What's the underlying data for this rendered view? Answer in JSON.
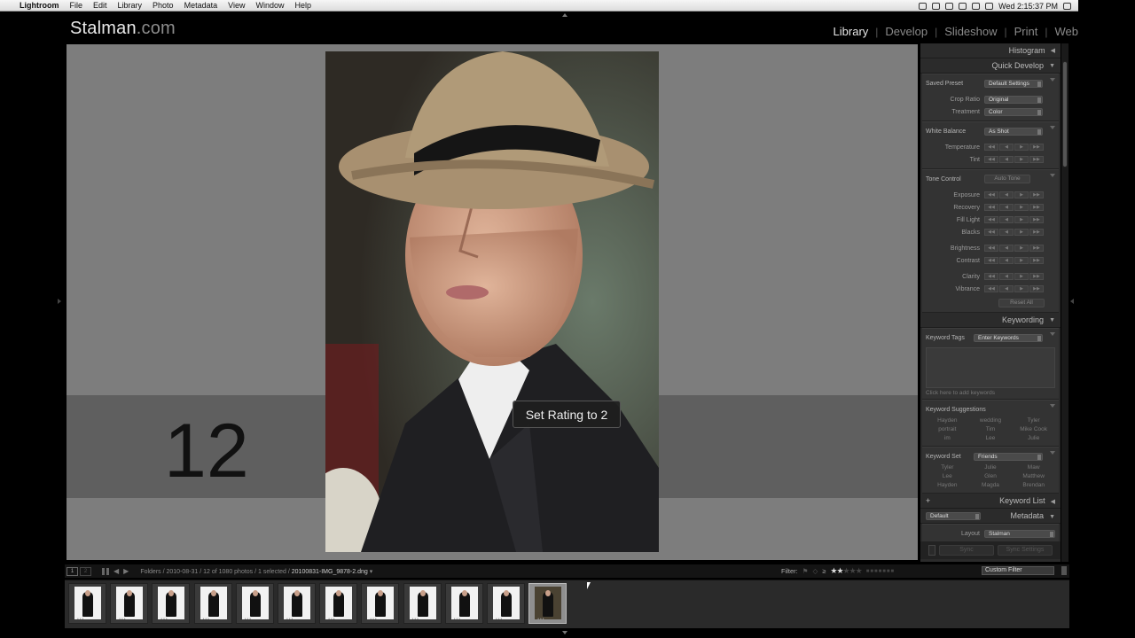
{
  "menubar": {
    "apple": "",
    "app": "Lightroom",
    "items": [
      "File",
      "Edit",
      "Library",
      "Photo",
      "Metadata",
      "View",
      "Window",
      "Help"
    ],
    "clock": "Wed 2:15:37 PM"
  },
  "identity": {
    "name": "Stalman",
    "suffix": ".com"
  },
  "modules": [
    "Library",
    "Develop",
    "Slideshow",
    "Print",
    "Web"
  ],
  "center": {
    "big_number": "12",
    "toast": "Set Rating to 2"
  },
  "panel": {
    "histogram": "Histogram",
    "quick_develop": "Quick Develop",
    "saved_preset": {
      "label": "Saved Preset",
      "value": "Default Settings"
    },
    "crop_ratio": {
      "label": "Crop Ratio",
      "value": "Original"
    },
    "treatment": {
      "label": "Treatment",
      "value": "Color"
    },
    "white_balance": {
      "label": "White Balance",
      "value": "As Shot"
    },
    "temperature": "Temperature",
    "tint": "Tint",
    "tone_control": {
      "label": "Tone Control",
      "button": "Auto Tone"
    },
    "tone_rows": [
      "Exposure",
      "Recovery",
      "Fill Light",
      "Blacks"
    ],
    "presence_rows": [
      "Brightness",
      "Contrast"
    ],
    "clarity_rows": [
      "Clarity",
      "Vibrance"
    ],
    "reset_all": "Reset All",
    "keywording": "Keywording",
    "keyword_tags": {
      "label": "Keyword Tags",
      "value": "Enter Keywords"
    },
    "click_hint": "Click here to add keywords",
    "keyword_suggestions": "Keyword Suggestions",
    "suggestions": [
      "Hayden",
      "wedding",
      "Tyler",
      "portrait",
      "Tim",
      "Mike Cook",
      "im",
      "Lee",
      "Julie"
    ],
    "keyword_set": {
      "label": "Keyword Set",
      "value": "Friends"
    },
    "set_words": [
      "Tyler",
      "Julie",
      "Maw",
      "Lee",
      "Glen",
      "Matthew",
      "Hayden",
      "Magda",
      "Brendan"
    ],
    "keyword_list": "Keyword List",
    "plus": "+",
    "metadata": "Metadata",
    "metadata_preset": "Default",
    "layout": "Layout",
    "layout_value": "Stalman",
    "sync": "Sync",
    "sync_settings": "Sync Settings"
  },
  "filmbar": {
    "view1": "1",
    "view2": "2",
    "path_prefix": "Folders / 2010-08-31 / 12 of 1080 photos / 1 selected /",
    "file": "20100831-IMG_9878-2.dng",
    "filter_label": "Filter:",
    "rating_op": "≥",
    "rating_value": 2,
    "custom_filter": "Custom Filter"
  },
  "filmstrip": {
    "count": 12,
    "selected_index": 11
  },
  "colors": {
    "accent": "#e6e6e6",
    "panel": "#2b2b2b",
    "canvas": "#7d7d7d"
  }
}
